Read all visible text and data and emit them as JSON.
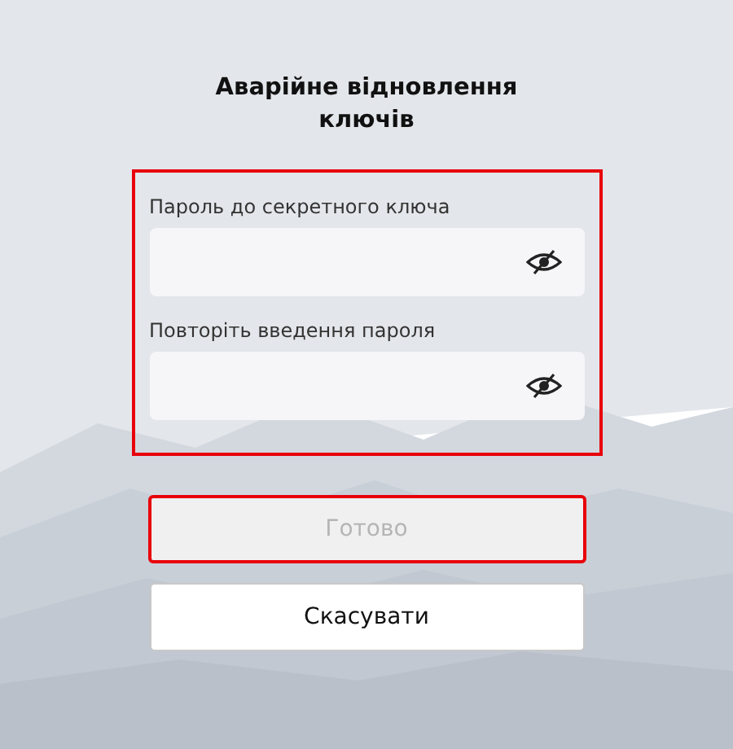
{
  "title": "Аварійне відновлення ключів",
  "password_group": {
    "highlighted": true,
    "fields": [
      {
        "label": "Пароль до секретного ключа",
        "masked": true
      },
      {
        "label": "Повторіть введення пароля",
        "masked": true
      }
    ]
  },
  "buttons": [
    {
      "label": "Готово",
      "disabled": true,
      "highlighted": true
    },
    {
      "label": "Скасувати",
      "disabled": false,
      "highlighted": false
    }
  ]
}
